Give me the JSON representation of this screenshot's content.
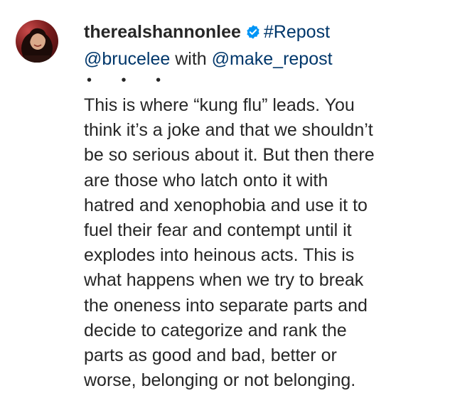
{
  "comment": {
    "username": "therealshannonlee",
    "verified_icon": "verified-badge-icon",
    "hashtag": "#Repost",
    "mention_1": "@brucelee",
    "connector": "with",
    "mention_2": "@make_repost",
    "separator": "• • •",
    "body_lines": [
      "This is where “kung flu” leads. You",
      "think it’s a joke and that we shouldn’t",
      "be so serious about it. But then there",
      "are those who latch onto it with",
      "hatred and xenophobia and use it to",
      "fuel their fear and contempt until it",
      "explodes into heinous acts. This is",
      "what happens when we try to break",
      "the oneness into separate parts and",
      "decide to categorize and rank the",
      "parts as good and bad, better or",
      "worse, belonging or not belonging."
    ]
  },
  "colors": {
    "text": "#262626",
    "link": "#00376b",
    "verified_badge": "#0095f6"
  }
}
